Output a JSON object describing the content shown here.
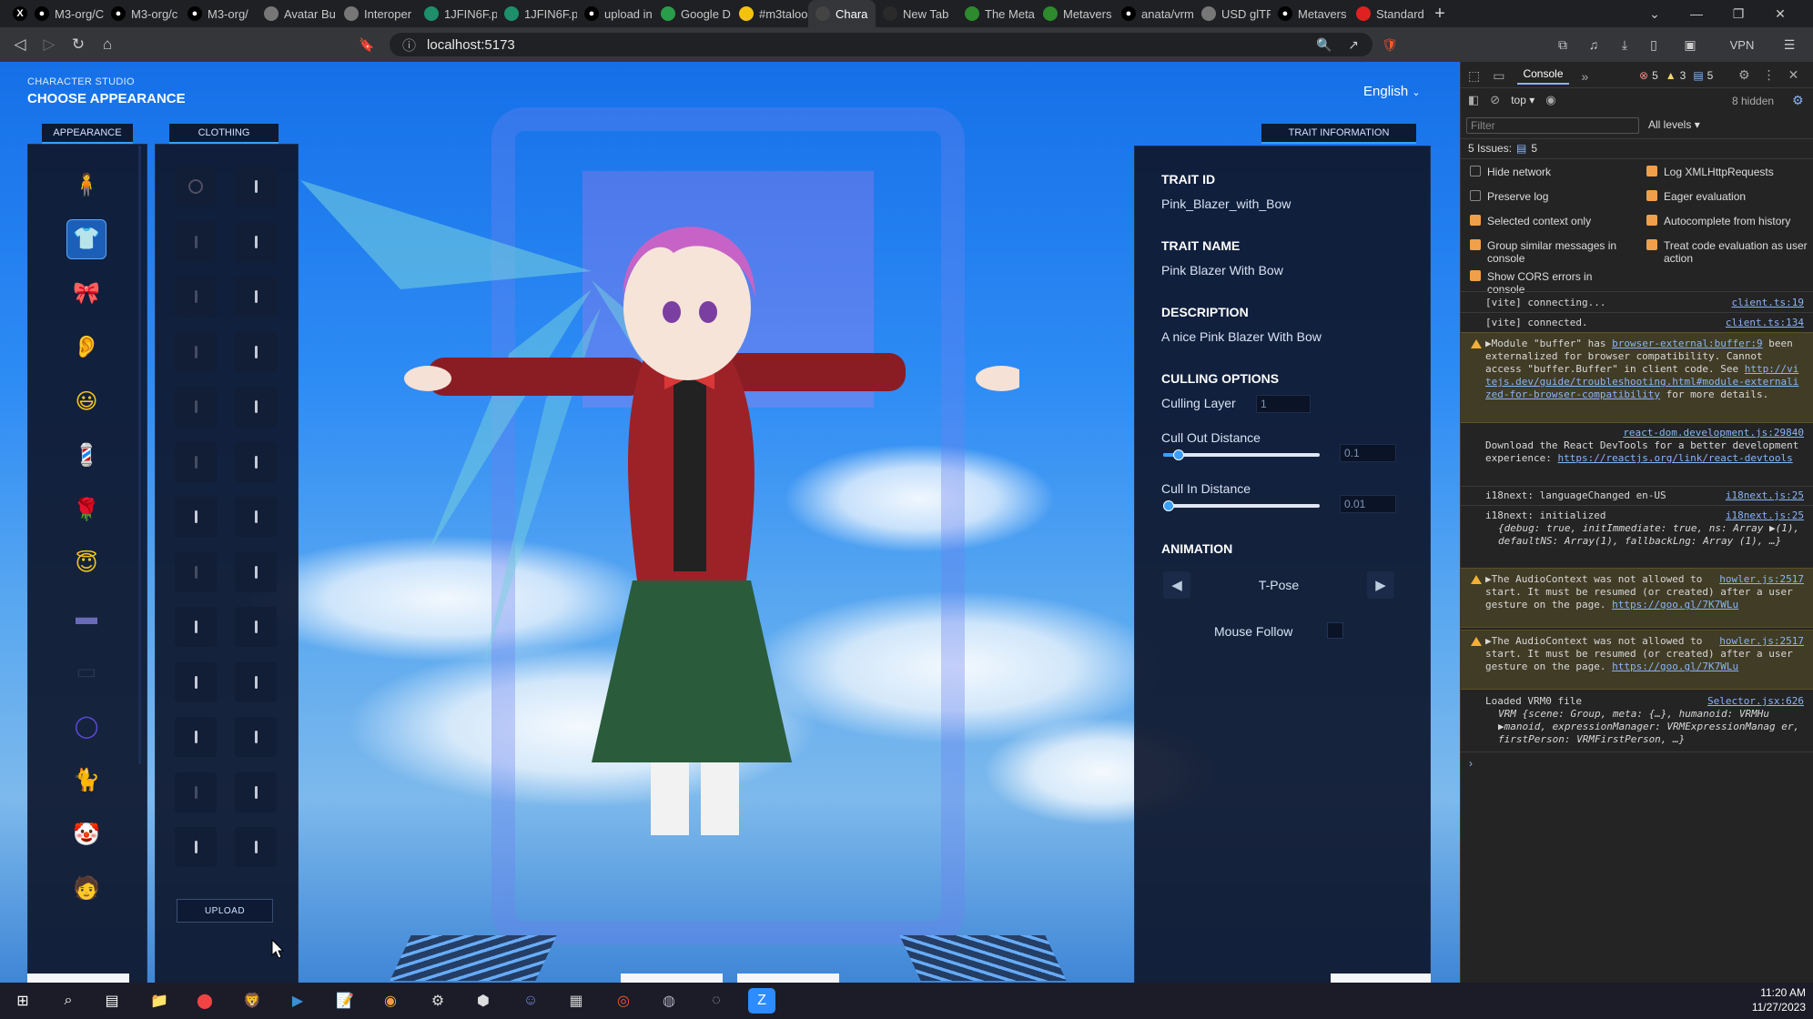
{
  "browser": {
    "tabs": [
      {
        "label": "",
        "icon": "x-logo",
        "color": "#000000"
      },
      {
        "label": "M3-org/C",
        "icon": "github-icon",
        "color": "#000000"
      },
      {
        "label": "M3-org/c",
        "icon": "github-icon",
        "color": "#000000"
      },
      {
        "label": "M3-org/",
        "icon": "github-icon",
        "color": "#000000"
      },
      {
        "label": "Avatar Bu",
        "icon": "doc-icon",
        "color": "#777777"
      },
      {
        "label": "Interoper",
        "icon": "doc-icon",
        "color": "#777777"
      },
      {
        "label": "1JFIN6F.p",
        "icon": "huggingface-icon",
        "color": "#1e8f6a"
      },
      {
        "label": "1JFIN6F.p",
        "icon": "huggingface-icon",
        "color": "#1e8f6a"
      },
      {
        "label": "upload in",
        "icon": "github-icon",
        "color": "#000000"
      },
      {
        "label": "Google D",
        "icon": "drive-icon",
        "color": "#2a9d4a"
      },
      {
        "label": "#m3taloo",
        "icon": "slack-icon",
        "color": "#f4c20d"
      },
      {
        "label": "Chara",
        "icon": "app-icon",
        "color": "#444444",
        "active": true
      },
      {
        "label": "New Tab",
        "icon": "blank-icon",
        "color": "#2a2a2a"
      },
      {
        "label": "The Meta",
        "icon": "mv-icon",
        "color": "#2d8a2d"
      },
      {
        "label": "Metavers",
        "icon": "mv-icon",
        "color": "#2d8a2d"
      },
      {
        "label": "anata/vrm",
        "icon": "github-icon",
        "color": "#000000"
      },
      {
        "label": "USD glTF",
        "icon": "doc-icon",
        "color": "#777777"
      },
      {
        "label": "Metavers",
        "icon": "github-icon",
        "color": "#000000"
      },
      {
        "label": "Standard",
        "icon": "youtube-icon",
        "color": "#e02020"
      }
    ],
    "url": "localhost:5173",
    "vpn_label": "VPN"
  },
  "studio": {
    "label": "CHARACTER STUDIO",
    "title": "CHOOSE APPEARANCE",
    "language": "English",
    "appearance_tab": "APPEARANCE",
    "clothing_tab": "CLOTHING",
    "upload_label": "UPLOAD",
    "appearance_icons": [
      {
        "name": "body-icon",
        "glyph": "🧍",
        "color": "#f0b03a"
      },
      {
        "name": "shirt-icon",
        "glyph": "👕",
        "color": "#b48be0",
        "selected": true
      },
      {
        "name": "bow-icon",
        "glyph": "🎀",
        "color": "#e0303a"
      },
      {
        "name": "ear-icon",
        "glyph": "👂",
        "color": "#f3c26a"
      },
      {
        "name": "face-icon",
        "glyph": "😃",
        "color": "#f5c518"
      },
      {
        "name": "barber-pole-icon",
        "glyph": "💈",
        "color": "#d0d6e8"
      },
      {
        "name": "rose-icon",
        "glyph": "🌹",
        "color": "#d2202a"
      },
      {
        "name": "halo-icon",
        "glyph": "😇",
        "color": "#f5c518"
      },
      {
        "name": "hat-icon",
        "glyph": "▬",
        "color": "#6a6ab8"
      },
      {
        "name": "glasses-icon",
        "glyph": "▭",
        "color": "#2a3450"
      },
      {
        "name": "ring-icon",
        "glyph": "◯",
        "color": "#5a4ad8"
      },
      {
        "name": "cat-icon",
        "glyph": "🐈",
        "color": "#e8a22a"
      },
      {
        "name": "clown-icon",
        "glyph": "🤡",
        "color": "#e8e8e8"
      },
      {
        "name": "person-icon",
        "glyph": "🧑",
        "color": "#f0b03a"
      }
    ]
  },
  "trait": {
    "tab": "TRAIT INFORMATION",
    "id_label": "TRAIT ID",
    "id_value": "Pink_Blazer_with_Bow",
    "name_label": "TRAIT NAME",
    "name_value": "Pink Blazer With Bow",
    "desc_label": "DESCRIPTION",
    "desc_value": "A nice Pink Blazer With Bow",
    "culling_label": "CULLING OPTIONS",
    "culling_layer_label": "Culling Layer",
    "culling_layer_value": "1",
    "cull_out_label": "Cull Out Distance",
    "cull_out_value": "0.1",
    "cull_out_level": 0.1,
    "cull_in_label": "Cull In Distance",
    "cull_in_value": "0.01",
    "cull_in_level": 0.01,
    "animation_label": "ANIMATION",
    "animation_name": "T-Pose",
    "mouse_follow_label": "Mouse Follow"
  },
  "devtools": {
    "active_tab": "Console",
    "errors": "5",
    "warnings": "3",
    "issues_badge": "5",
    "context": "top",
    "hidden": "8 hidden",
    "filter_placeholder": "Filter",
    "levels": "All levels",
    "issues_label": "5 Issues:",
    "issues_count": "5",
    "settings": [
      {
        "label": "Hide network",
        "on": false
      },
      {
        "label": "Log XMLHttpRequests",
        "on": true
      },
      {
        "label": "Preserve log",
        "on": false
      },
      {
        "label": "Eager evaluation",
        "on": true
      },
      {
        "label": "Selected context only",
        "on": true
      },
      {
        "label": "Autocomplete from history",
        "on": true
      },
      {
        "label": "Group similar messages in console",
        "on": true
      },
      {
        "label": "Treat code evaluation as user action",
        "on": true
      },
      {
        "label": "Show CORS errors in console",
        "on": true
      }
    ],
    "log": {
      "l1": "[vite] connecting...",
      "l1src": "client.ts:19",
      "l2": "[vite] connected.",
      "l2src": "client.ts:134",
      "w1a": "▶Module \"buffer\" has ",
      "w1link": "browser-external:buffer:9",
      "w1b": " been externalized for browser compatibility. Cannot access \"buffer.Buffer\" in client code. See ",
      "w1url": "http://vitejs.dev/guide/troubleshooting.html#module-externalized-for-browser-compatibility",
      "w1c": " for more details.",
      "r1src": "react-dom.development.js:29840",
      "r1": "Download the React DevTools for a better development experience: ",
      "r1url": "https://reactjs.org/link/react-devtools",
      "i1": "i18next: languageChanged en-US",
      "i1src": "i18next.js:25",
      "i2": "i18next: initialized",
      "i2src": "i18next.js:25",
      "i2b": "{debug: true, initImmediate: true, ns: Array ▶(1), defaultNS: Array(1), fallbackLng: Array (1), …}",
      "a1": "▶The AudioContext was not allowed to start. It must be resumed (or created) after a user gesture on the page. ",
      "a1src": "howler.js:2517",
      "a1url": "https://goo.gl/7K7WLu",
      "a2": "▶The AudioContext was not allowed to start. It must be resumed (or created) after a user gesture on the page. ",
      "a2src": "howler.js:2517",
      "a2url": "https://goo.gl/7K7WLu",
      "v1": "Loaded VRM0 file",
      "v1src": "Selector.jsx:626",
      "v2": "VRM {scene: Group, meta: {…}, humanoid: VRMHu ▶manoid, expressionManager: VRMExpressionManag er, firstPerson: VRMFirstPerson, …}"
    }
  },
  "taskbar": {
    "time": "11:20 AM",
    "date": "11/27/2023"
  },
  "colors": {
    "accent": "#3aa0ff",
    "panel": "#0f182e"
  }
}
